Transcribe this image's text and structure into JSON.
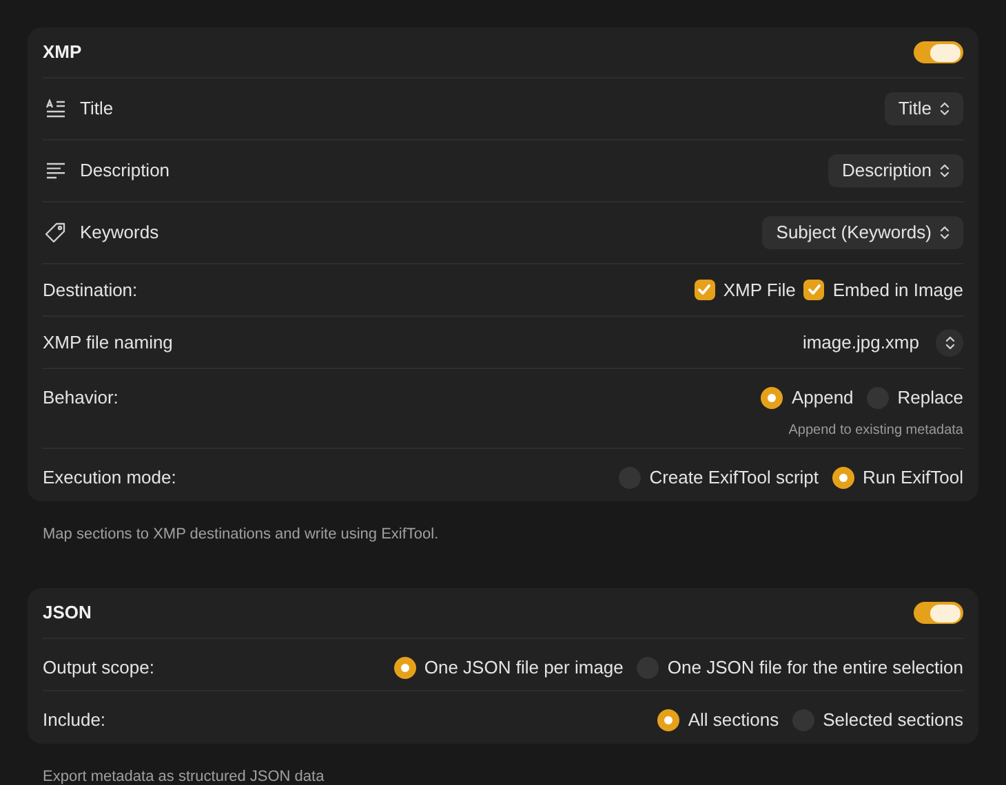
{
  "sections": [
    {
      "title": "XMP",
      "enabled": true,
      "caption": "Map sections to XMP destinations and write using ExifTool.",
      "rows": [
        {
          "kind": "mapping",
          "label": "Title",
          "value": "Title"
        },
        {
          "kind": "mapping",
          "label": "Description",
          "value": "Description"
        },
        {
          "kind": "mapping",
          "label": "Keywords",
          "value": "Subject (Keywords)"
        },
        {
          "kind": "checkboxes",
          "label": "Destination:",
          "options": [
            {
              "label": "XMP File",
              "checked": true
            },
            {
              "label": "Embed in Image",
              "checked": true
            }
          ]
        },
        {
          "kind": "stepper",
          "label": "XMP file naming",
          "value": "image.jpg.xmp"
        },
        {
          "kind": "radios",
          "label": "Behavior:",
          "options": [
            {
              "label": "Append",
              "selected": true
            },
            {
              "label": "Replace",
              "selected": false
            }
          ],
          "hint": "Append to existing metadata"
        },
        {
          "kind": "radios",
          "label": "Execution mode:",
          "options": [
            {
              "label": "Create ExifTool script",
              "selected": false
            },
            {
              "label": "Run ExifTool",
              "selected": true
            }
          ]
        }
      ]
    },
    {
      "title": "JSON",
      "enabled": true,
      "caption": "Export metadata as structured JSON data",
      "rows": [
        {
          "kind": "radios",
          "label": "Output scope:",
          "options": [
            {
              "label": "One JSON file per image",
              "selected": true
            },
            {
              "label": "One JSON file for the entire selection",
              "selected": false
            }
          ]
        },
        {
          "kind": "radios",
          "label": "Include:",
          "options": [
            {
              "label": "All sections",
              "selected": true
            },
            {
              "label": "Selected sections",
              "selected": false
            }
          ]
        }
      ]
    }
  ]
}
